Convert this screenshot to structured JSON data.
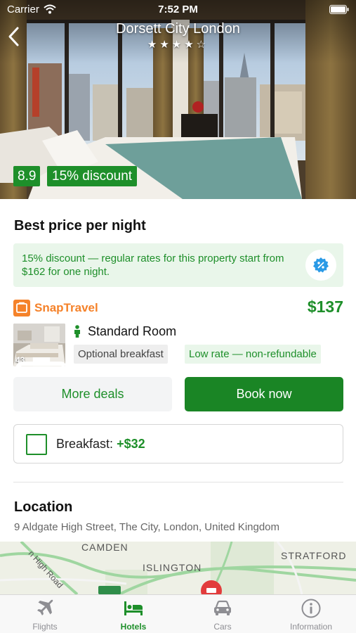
{
  "status_bar": {
    "carrier": "Carrier",
    "time": "7:52 PM"
  },
  "hotel": {
    "name": "Dorsett City London",
    "stars": "★★★★☆",
    "rating": "8.9",
    "discount_badge": "15% discount"
  },
  "best_price": {
    "title": "Best price per night",
    "info": "15% discount — regular rates for this property start from $162 for one night.",
    "provider": "SnapTravel",
    "price": "$137",
    "room_name": "Standard Room",
    "photo_count": "43",
    "tags": [
      "Optional breakfast",
      "Low rate — non-refundable"
    ],
    "more_deals_label": "More deals",
    "book_now_label": "Book now",
    "breakfast_label": "Breakfast:",
    "breakfast_price": "+$32"
  },
  "location": {
    "title": "Location",
    "address": "9 Aldgate High Street, The City, London, United Kingdom",
    "map_labels": {
      "camden": "CAMDEN",
      "islington": "ISLINGTON",
      "stratford": "STRATFORD",
      "road": "n High Road"
    }
  },
  "tabs": [
    {
      "label": "Flights",
      "icon": "plane-icon",
      "active": false
    },
    {
      "label": "Hotels",
      "icon": "bed-icon",
      "active": true
    },
    {
      "label": "Cars",
      "icon": "car-icon",
      "active": false
    },
    {
      "label": "Information",
      "icon": "info-icon",
      "active": false
    }
  ],
  "colors": {
    "accent_green": "#1e8f2a",
    "provider_orange": "#f5822a",
    "tab_inactive": "#8e8e93"
  }
}
